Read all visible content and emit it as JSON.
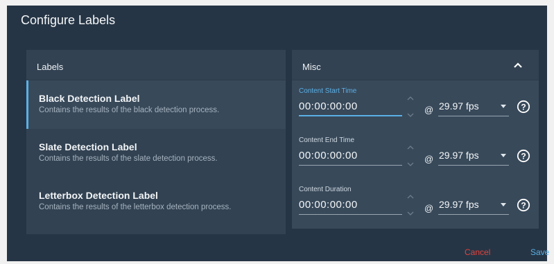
{
  "dialog": {
    "title": "Configure Labels",
    "cancel_label": "Cancel",
    "save_label": "Save"
  },
  "labels_panel": {
    "header": "Labels",
    "items": [
      {
        "title": "Black Detection Label",
        "description": "Contains the results of the black detection process.",
        "selected": true
      },
      {
        "title": "Slate Detection Label",
        "description": "Contains the results of the slate detection process.",
        "selected": false
      },
      {
        "title": "Letterbox Detection Label",
        "description": "Contains the results of the letterbox detection process.",
        "selected": false
      }
    ]
  },
  "misc_panel": {
    "header": "Misc",
    "fields": [
      {
        "label": "Content Start Time",
        "value": "00:00:00:00",
        "at": "@",
        "fps": "29.97 fps",
        "active": true
      },
      {
        "label": "Content End Time",
        "value": "00:00:00:00",
        "at": "@",
        "fps": "29.97 fps",
        "active": false
      },
      {
        "label": "Content Duration",
        "value": "00:00:00:00",
        "at": "@",
        "fps": "29.97 fps",
        "active": false
      }
    ]
  },
  "colors": {
    "dialog_bg": "#263545",
    "panel_bg": "#324252",
    "accent": "#5ab0e6",
    "cancel": "#e0443e"
  }
}
